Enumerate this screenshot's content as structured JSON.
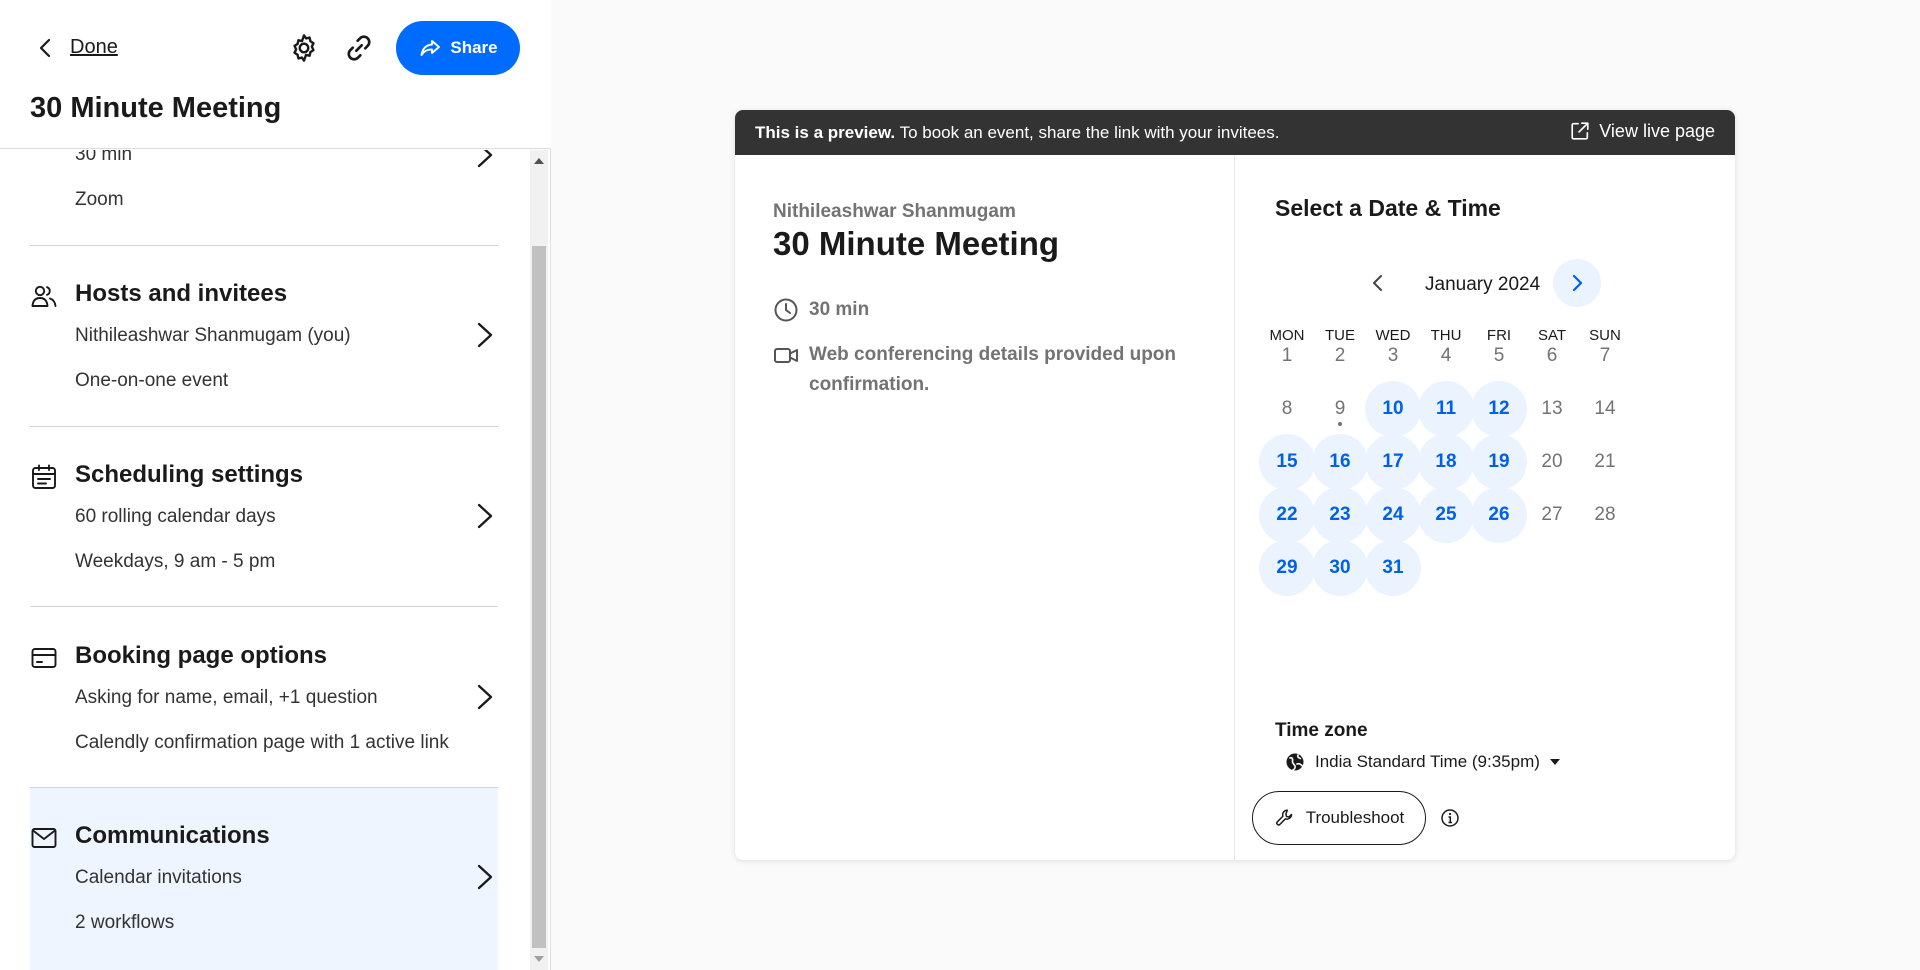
{
  "header": {
    "done_label": "Done",
    "share_label": "Share",
    "title": "30 Minute Meeting"
  },
  "sections": {
    "event": {
      "line1": "30 min",
      "line2": "Zoom"
    },
    "hosts": {
      "title": "Hosts and invitees",
      "line1": "Nithileashwar Shanmugam (you)",
      "line2": "One-on-one event"
    },
    "scheduling": {
      "title": "Scheduling settings",
      "line1": "60 rolling calendar days",
      "line2": "Weekdays, 9 am - 5 pm"
    },
    "booking": {
      "title": "Booking page options",
      "line1": "Asking for name, email, +1 question",
      "line2": "Calendly confirmation page with 1 active link"
    },
    "communications": {
      "title": "Communications",
      "line1": "Calendar invitations",
      "line2": "2 workflows"
    }
  },
  "preview": {
    "banner_bold": "This is a preview.",
    "banner_text": " To book an event, share the link with your invitees.",
    "view_live": "View live page",
    "organizer": "Nithileashwar Shanmugam",
    "title": "30 Minute Meeting",
    "duration": "30 min",
    "location_line1": "Web conferencing details provided upon",
    "location_line2": "confirmation.",
    "select_title": "Select a Date & Time",
    "month": "January 2024",
    "weekdays": [
      "MON",
      "TUE",
      "WED",
      "THU",
      "FRI",
      "SAT",
      "SUN"
    ],
    "days": [
      {
        "d": "1",
        "avail": false
      },
      {
        "d": "2",
        "avail": false
      },
      {
        "d": "3",
        "avail": false
      },
      {
        "d": "4",
        "avail": false
      },
      {
        "d": "5",
        "avail": false
      },
      {
        "d": "6",
        "avail": false
      },
      {
        "d": "7",
        "avail": false
      },
      {
        "d": "8",
        "avail": false
      },
      {
        "d": "9",
        "avail": false,
        "today": true
      },
      {
        "d": "10",
        "avail": true
      },
      {
        "d": "11",
        "avail": true
      },
      {
        "d": "12",
        "avail": true
      },
      {
        "d": "13",
        "avail": false
      },
      {
        "d": "14",
        "avail": false
      },
      {
        "d": "15",
        "avail": true
      },
      {
        "d": "16",
        "avail": true
      },
      {
        "d": "17",
        "avail": true
      },
      {
        "d": "18",
        "avail": true
      },
      {
        "d": "19",
        "avail": true
      },
      {
        "d": "20",
        "avail": false
      },
      {
        "d": "21",
        "avail": false
      },
      {
        "d": "22",
        "avail": true
      },
      {
        "d": "23",
        "avail": true
      },
      {
        "d": "24",
        "avail": true
      },
      {
        "d": "25",
        "avail": true
      },
      {
        "d": "26",
        "avail": true
      },
      {
        "d": "27",
        "avail": false
      },
      {
        "d": "28",
        "avail": false
      },
      {
        "d": "29",
        "avail": true
      },
      {
        "d": "30",
        "avail": true
      },
      {
        "d": "31",
        "avail": true
      }
    ],
    "timezone_label": "Time zone",
    "timezone_value": "India Standard Time (9:35pm)",
    "troubleshoot": "Troubleshoot"
  },
  "colors": {
    "brand": "#006bff",
    "available_bg": "#ebf3ff",
    "available_text": "#0060e6",
    "banner_bg": "#333333",
    "selected_section_bg": "#eef5ff"
  }
}
